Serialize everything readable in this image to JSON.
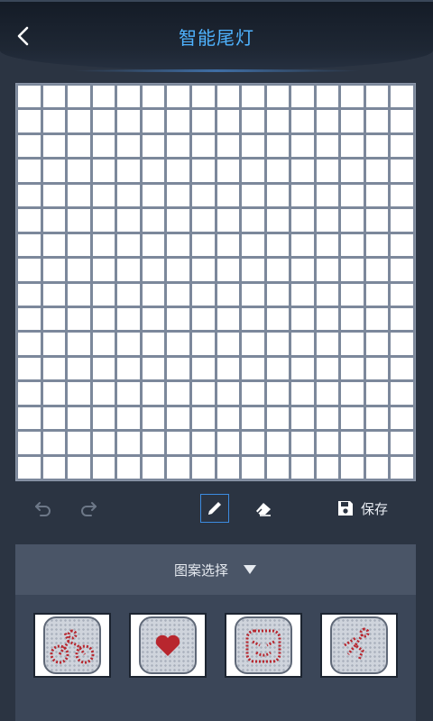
{
  "header": {
    "title": "智能尾灯"
  },
  "toolbar": {
    "save_label": "保存"
  },
  "panel": {
    "title": "图案选择"
  },
  "patterns": [
    "bicycle-pattern",
    "heart-pattern",
    "face-pattern",
    "rider-pattern"
  ],
  "colors": {
    "title": "#4fb3ff",
    "accent": "#3c8be0",
    "led_red": "#b8262e"
  }
}
